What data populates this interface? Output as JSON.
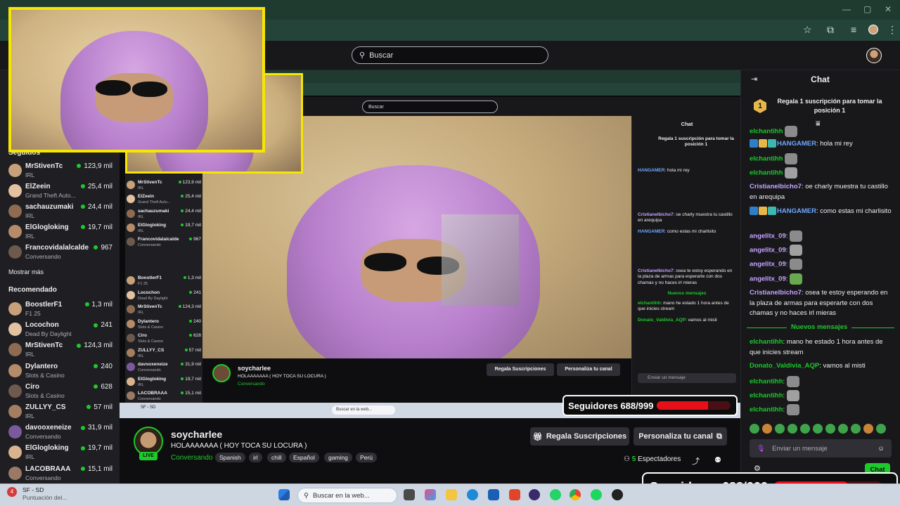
{
  "search": {
    "placeholder": "Buscar"
  },
  "sidebar": {
    "followed_heading": "Seguidos",
    "followed": [
      {
        "name": "MrStivenTc",
        "game": "IRL",
        "viewers": "123,9 mil"
      },
      {
        "name": "ElZeein",
        "game": "Grand Theft Auto...",
        "viewers": "25,4 mil"
      },
      {
        "name": "sachauzumaki",
        "game": "IRL",
        "viewers": "24,4 mil"
      },
      {
        "name": "ElGlogloking",
        "game": "IRL",
        "viewers": "19,7 mil"
      },
      {
        "name": "Francovidalalcalde",
        "game": "Conversando",
        "viewers": "967"
      }
    ],
    "show_more": "Mostrar más",
    "recommended_heading": "Recomendado",
    "recommended": [
      {
        "name": "BoostlerF1",
        "game": "F1 25",
        "viewers": "1,3 mil"
      },
      {
        "name": "Locochon",
        "game": "Dead By Daylight",
        "viewers": "241"
      },
      {
        "name": "MrStivenTc",
        "game": "IRL",
        "viewers": "124,3 mil"
      },
      {
        "name": "Dylantero",
        "game": "Slots & Casino",
        "viewers": "240"
      },
      {
        "name": "Ciro",
        "game": "Slots & Casino",
        "viewers": "628"
      },
      {
        "name": "ZULLYY_CS",
        "game": "IRL",
        "viewers": "57 mil"
      },
      {
        "name": "davooxeneize",
        "game": "Conversando",
        "viewers": "31,9 mil"
      },
      {
        "name": "ElGlogloking",
        "game": "IRL",
        "viewers": "19,7 mil"
      },
      {
        "name": "LACOBRAAA",
        "game": "Conversando",
        "viewers": "15,1 mil"
      }
    ]
  },
  "stream": {
    "streamer": "soycharlee",
    "live": "LIVE",
    "title": "HOLAAAAAAA ( HOY TOCA SU LOCURA )",
    "category": "Conversando",
    "tags": [
      "Spanish",
      "irl",
      "chill",
      "Español",
      "gaming",
      "Perú"
    ],
    "gift_button": "Regala Suscripciones",
    "customize_button": "Personaliza tu canal",
    "viewers_count": "5",
    "viewers_label": "Espectadores"
  },
  "chat": {
    "title": "Chat",
    "pinned": "Regala 1 suscripción para tomar la posición 1",
    "pinned_rank": "1",
    "messages": [
      {
        "user": "elchantihh",
        "text": "",
        "color": "#1ccb2b"
      },
      {
        "user": "HANGAMER",
        "text": ": hola mi rey",
        "color": "#6ea7ff"
      },
      {
        "user": "elchantihh",
        "text": "",
        "color": "#1ccb2b"
      },
      {
        "user": "elchantihh",
        "text": "",
        "color": "#1ccb2b"
      },
      {
        "user": "Cristianelbicho7",
        "text": ": oe charly muestra tu castillo en arequipa",
        "color": "#c7a4ff"
      },
      {
        "user": "HANGAMER",
        "text": ": como estas mi charlisito",
        "color": "#6ea7ff"
      },
      {
        "user": "angelitx_09",
        "text": ":",
        "color": "#c7a4ff"
      },
      {
        "user": "angelitx_09",
        "text": ":",
        "color": "#c7a4ff"
      },
      {
        "user": "angelitx_09",
        "text": ":",
        "color": "#c7a4ff"
      },
      {
        "user": "angelitx_09",
        "text": ":",
        "color": "#c7a4ff"
      },
      {
        "user": "Cristianelbicho7",
        "text": ": osea te estoy esperando en la plaza de armas para esperarte con dos chamas y no haces irl mieras",
        "color": "#c7a4ff"
      }
    ],
    "new_messages": "Nuevos mensajes",
    "new": [
      {
        "user": "elchantihh",
        "text": ": mano he estado 1 hora antes de que inicies stream",
        "color": "#1ccb2b"
      },
      {
        "user": "Donato_Valdivia_AQP",
        "text": ": vamos al misti",
        "color": "#1ccb2b"
      },
      {
        "user": "elchantihh",
        "text": ":",
        "color": "#1ccb2b"
      },
      {
        "user": "elchantihh",
        "text": ":",
        "color": "#1ccb2b"
      },
      {
        "user": "elchantihh",
        "text": ":",
        "color": "#1ccb2b"
      }
    ],
    "input_placeholder": "Enviar un mensaje",
    "send_button": "Chat"
  },
  "goal": {
    "text": "Seguidores 688/999",
    "current": 688,
    "target": 999
  },
  "taskbar": {
    "app_title": "SF - SD",
    "app_subtitle": "Puntuación del...",
    "search_placeholder": "Buscar en la web...",
    "badge_count": "4"
  },
  "colors": {
    "accent": "#1ccb2b",
    "goal_bar": "#e5101a",
    "overlay_border": "#f6e600"
  }
}
